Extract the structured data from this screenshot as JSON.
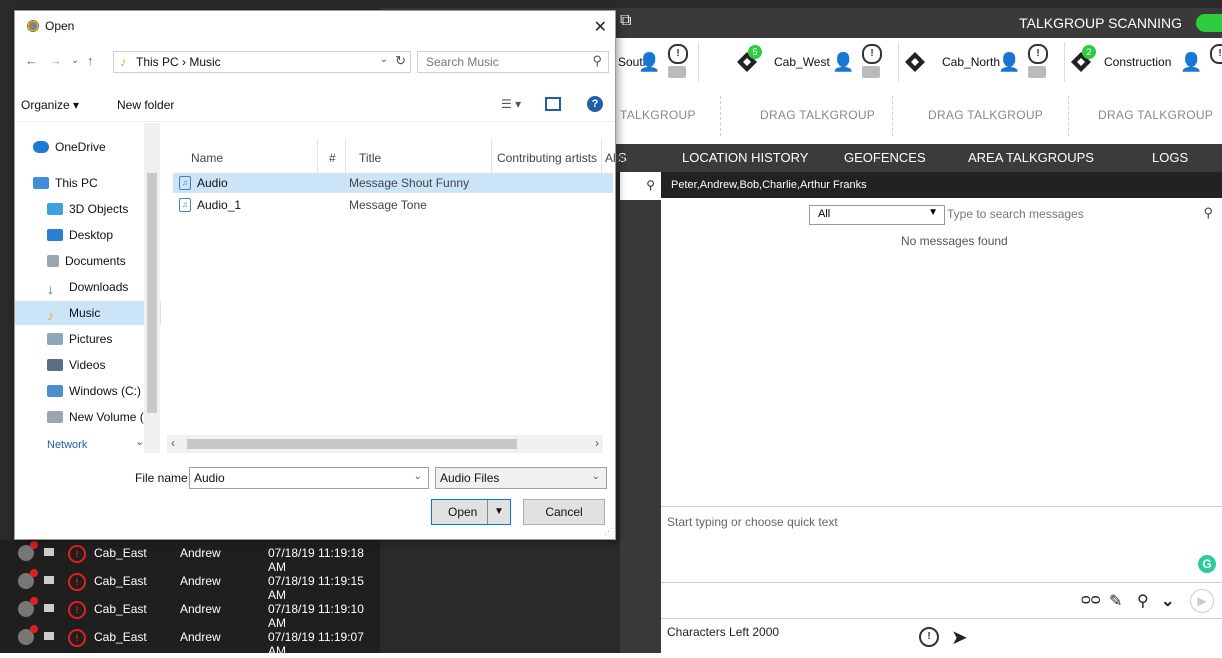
{
  "app": {
    "scanning_label": "TALKGROUP SCANNING",
    "talkgroups": [
      {
        "name": "South",
        "badge": ""
      },
      {
        "name": "Cab_West",
        "badge": "5"
      },
      {
        "name": "Cab_North",
        "badge": ""
      },
      {
        "name": "Construction",
        "badge": "2"
      }
    ],
    "drag_slots": [
      "TALKGROUP",
      "DRAG TALKGROUP",
      "DRAG TALKGROUP",
      "DRAG TALKGROUP"
    ],
    "tabs": [
      "S",
      "LOCATION HISTORY",
      "GEOFENCES",
      "AREA TALKGROUPS",
      "LOGS"
    ],
    "messages": {
      "recipients": "Peter,Andrew,Bob,Charlie,Arthur Franks",
      "filter_value": "All",
      "search_placeholder": "Type to search messages",
      "empty_text": "No messages found",
      "compose_placeholder": "Start typing or choose quick text",
      "chars_left": "Characters Left 2000"
    },
    "history": [
      {
        "talkgroup": "Cab_East",
        "user": "Andrew",
        "time": "07/18/19 11:19:18 AM"
      },
      {
        "talkgroup": "Cab_East",
        "user": "Andrew",
        "time": "07/18/19 11:19:15 AM"
      },
      {
        "talkgroup": "Cab_East",
        "user": "Andrew",
        "time": "07/18/19 11:19:10 AM"
      },
      {
        "talkgroup": "Cab_East",
        "user": "Andrew",
        "time": "07/18/19 11:19:07 AM"
      }
    ]
  },
  "dialog": {
    "title": "Open",
    "path": "This PC  ›  Music",
    "search_placeholder": "Search Music",
    "organize": "Organize ▾",
    "new_folder": "New folder",
    "nav": [
      {
        "label": "OneDrive",
        "color": "#1e78d7"
      },
      {
        "label": "This PC",
        "color": "#3c8fd8"
      },
      {
        "label": "3D Objects",
        "color": "#3fa0e0"
      },
      {
        "label": "Desktop",
        "color": "#2b7fd1"
      },
      {
        "label": "Documents",
        "color": "#9aa5b1"
      },
      {
        "label": "Downloads",
        "color": "#1e78d7"
      },
      {
        "label": "Music",
        "color": "#e0b030"
      },
      {
        "label": "Pictures",
        "color": "#8fa7bd"
      },
      {
        "label": "Videos",
        "color": "#5a6f86"
      },
      {
        "label": "Windows (C:)",
        "color": "#4a90d0"
      },
      {
        "label": "New Volume (D:",
        "color": "#9aa5b1"
      }
    ],
    "nav_more": "Network",
    "columns": [
      "Name",
      "#",
      "Title",
      "Contributing artists",
      "Albu"
    ],
    "files": [
      {
        "name": "Audio",
        "title": "Message Shout Funny",
        "selected": true
      },
      {
        "name": "Audio_1",
        "title": "Message Tone",
        "selected": false
      }
    ],
    "file_name_label": "File name:",
    "file_name_value": "Audio",
    "file_type": "Audio Files",
    "open_label": "Open",
    "cancel_label": "Cancel"
  }
}
